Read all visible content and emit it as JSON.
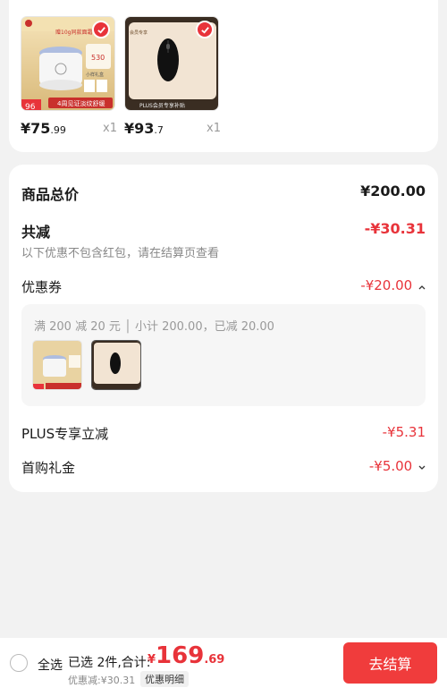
{
  "products": [
    {
      "price_int": "¥75",
      "price_dec": ".99",
      "qty": "x1"
    },
    {
      "price_int": "¥93",
      "price_dec": ".7",
      "qty": "x1"
    }
  ],
  "product_art": {
    "cream_headline": "赠10g同款面霜",
    "cream_badge": "4周见证淡纹舒缓",
    "cream_side": "530",
    "cream_side_label": "小样礼盒",
    "cream_price_tag": "96",
    "mouse_badge": "PLUS会员专享补贴",
    "mouse_corner": "会员专享"
  },
  "summary": {
    "total_label": "商品总价",
    "total_value": "¥200.00",
    "reduce_label": "共减",
    "reduce_value": "-¥30.31",
    "reduce_note": "以下优惠不包含红包，请在结算页查看",
    "coupon_label": "优惠券",
    "coupon_value": "-¥20.00",
    "coupon_desc": "满 200 减 20 元 │ 小计 200.00，已减 20.00",
    "plus_label": "PLUS专享立减",
    "plus_value": "-¥5.31",
    "first_label": "首购礼金",
    "first_value": "-¥5.00"
  },
  "bottom": {
    "select_all": "全选",
    "selected_text": "已选 2件,合计:",
    "currency": "¥",
    "total_int": "169",
    "total_dec": ".69",
    "discount_line": "优惠减:¥30.31",
    "detail_btn": "优惠明细",
    "checkout": "去结算"
  },
  "colors": {
    "accent": "#e8333a",
    "checkout_bg": "#f03c3c"
  }
}
